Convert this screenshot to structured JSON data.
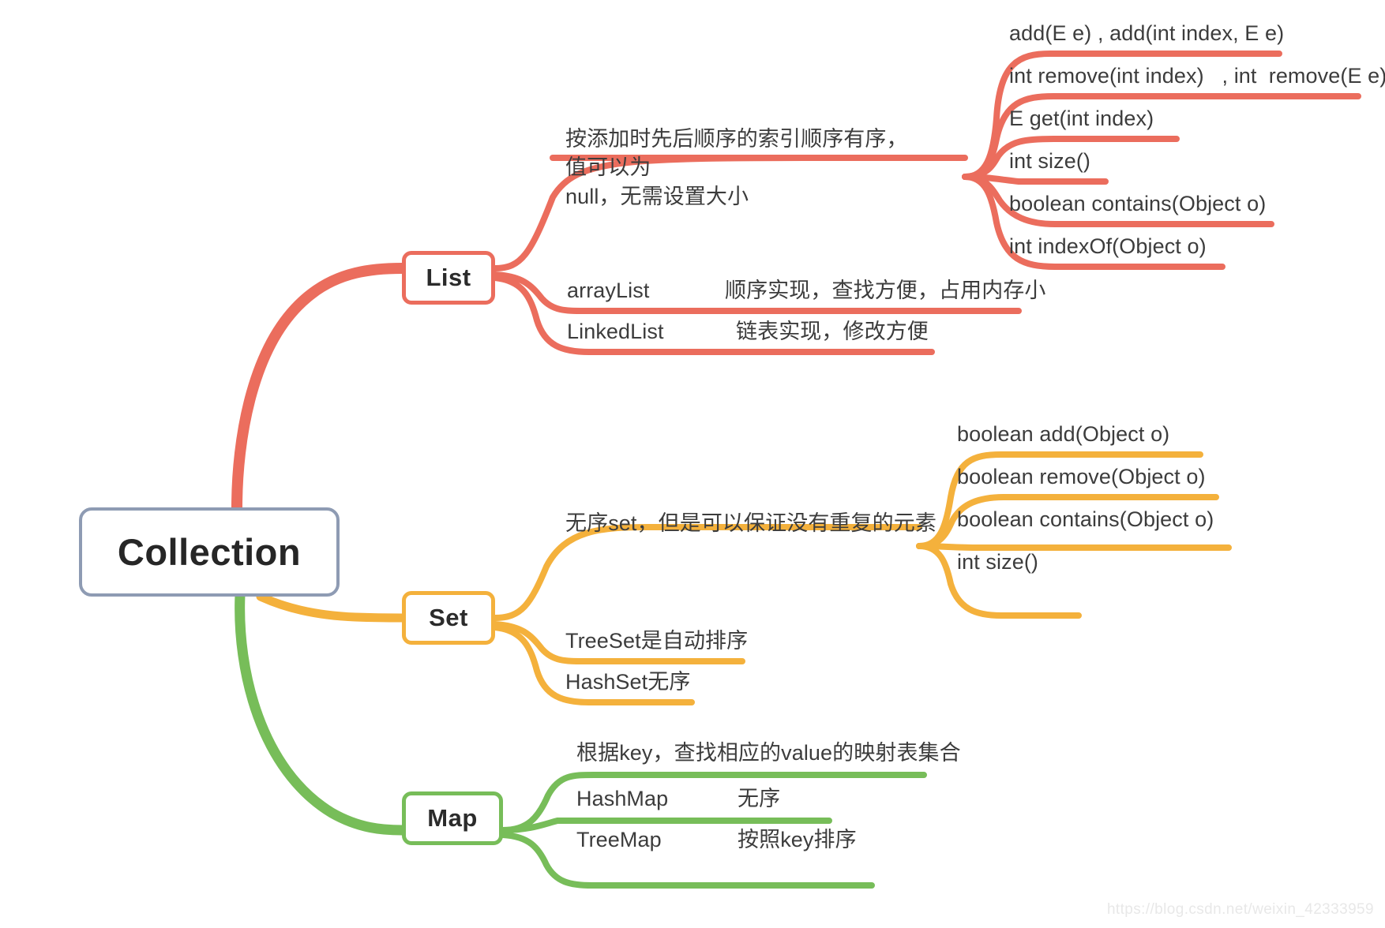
{
  "root": {
    "label": "Collection",
    "color": "#8e9bb3"
  },
  "branches": [
    {
      "label": "List",
      "color": "#eb6d5d",
      "description": "按添加时先后顺序的索引顺序有序，值可以为\nnull，无需设置大小",
      "methods": [
        "add(E e) , add(int index, E e)",
        "int remove(int index)   , int  remove(E e)",
        "E get(int index)",
        "int size()",
        "boolean contains(Object o)",
        "int indexOf(Object o)"
      ],
      "implementations": [
        {
          "name": "arrayList",
          "note": "顺序实现，查找方便，占用内存小"
        },
        {
          "name": "LinkedList",
          "note": "链表实现，修改方便"
        }
      ]
    },
    {
      "label": "Set",
      "color": "#f4b13c",
      "description": "无序set，但是可以保证没有重复的元素",
      "methods": [
        "boolean add(Object o)",
        "boolean remove(Object o)",
        "boolean contains(Object o)",
        "int size()"
      ],
      "implementations": [
        {
          "name": "TreeSet是自动排序",
          "note": ""
        },
        {
          "name": "HashSet无序",
          "note": ""
        }
      ]
    },
    {
      "label": "Map",
      "color": "#77bd59",
      "description": "根据key，查找相应的value的映射表集合",
      "methods": [],
      "implementations": [
        {
          "name": "HashMap",
          "note": "无序"
        },
        {
          "name": "TreeMap",
          "note": "按照key排序"
        }
      ]
    }
  ],
  "watermark": "https://blog.csdn.net/weixin_42333959"
}
